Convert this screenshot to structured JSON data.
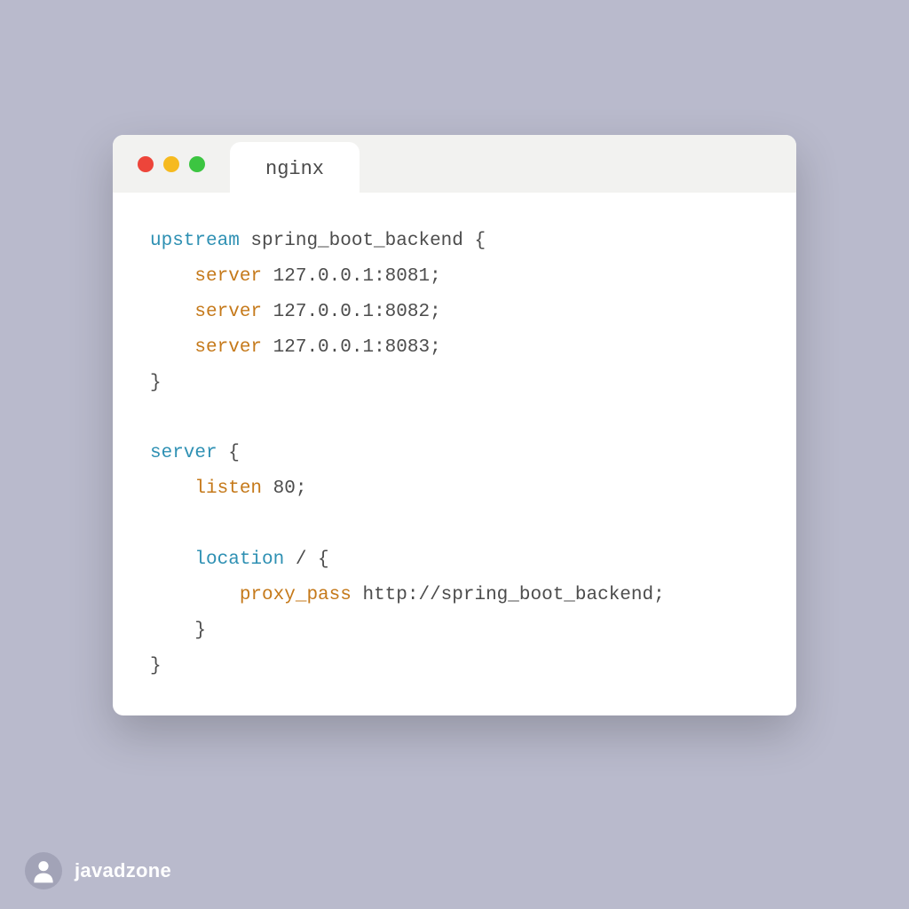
{
  "window": {
    "tab_label": "nginx"
  },
  "code": {
    "lines": [
      [
        {
          "cls": "tok-keyword",
          "t": "upstream"
        },
        {
          "cls": "tok-default",
          "t": " spring_boot_backend {"
        }
      ],
      [
        {
          "cls": "tok-default",
          "t": "    "
        },
        {
          "cls": "tok-directive",
          "t": "server"
        },
        {
          "cls": "tok-default",
          "t": " 127.0.0.1:8081;"
        }
      ],
      [
        {
          "cls": "tok-default",
          "t": "    "
        },
        {
          "cls": "tok-directive",
          "t": "server"
        },
        {
          "cls": "tok-default",
          "t": " 127.0.0.1:8082;"
        }
      ],
      [
        {
          "cls": "tok-default",
          "t": "    "
        },
        {
          "cls": "tok-directive",
          "t": "server"
        },
        {
          "cls": "tok-default",
          "t": " 127.0.0.1:8083;"
        }
      ],
      [
        {
          "cls": "tok-default",
          "t": "}"
        }
      ],
      [
        {
          "cls": "tok-default",
          "t": ""
        }
      ],
      [
        {
          "cls": "tok-keyword",
          "t": "server"
        },
        {
          "cls": "tok-default",
          "t": " {"
        }
      ],
      [
        {
          "cls": "tok-default",
          "t": "    "
        },
        {
          "cls": "tok-directive",
          "t": "listen"
        },
        {
          "cls": "tok-default",
          "t": " 80;"
        }
      ],
      [
        {
          "cls": "tok-default",
          "t": ""
        }
      ],
      [
        {
          "cls": "tok-default",
          "t": "    "
        },
        {
          "cls": "tok-keyword",
          "t": "location"
        },
        {
          "cls": "tok-default",
          "t": " / {"
        }
      ],
      [
        {
          "cls": "tok-default",
          "t": "        "
        },
        {
          "cls": "tok-directive",
          "t": "proxy_pass"
        },
        {
          "cls": "tok-default",
          "t": " http://spring_boot_backend;"
        }
      ],
      [
        {
          "cls": "tok-default",
          "t": "    }"
        }
      ],
      [
        {
          "cls": "tok-default",
          "t": "}"
        }
      ]
    ]
  },
  "footer": {
    "username": "javadzone"
  },
  "colors": {
    "bg": "#b9bacc",
    "window_bg": "#ffffff",
    "titlebar_bg": "#f2f2f0",
    "red": "#ed453a",
    "yellow": "#f6ba1f",
    "green": "#3cc541",
    "keyword": "#2e90b3",
    "directive": "#c5791a",
    "text": "#4c4c4c"
  }
}
